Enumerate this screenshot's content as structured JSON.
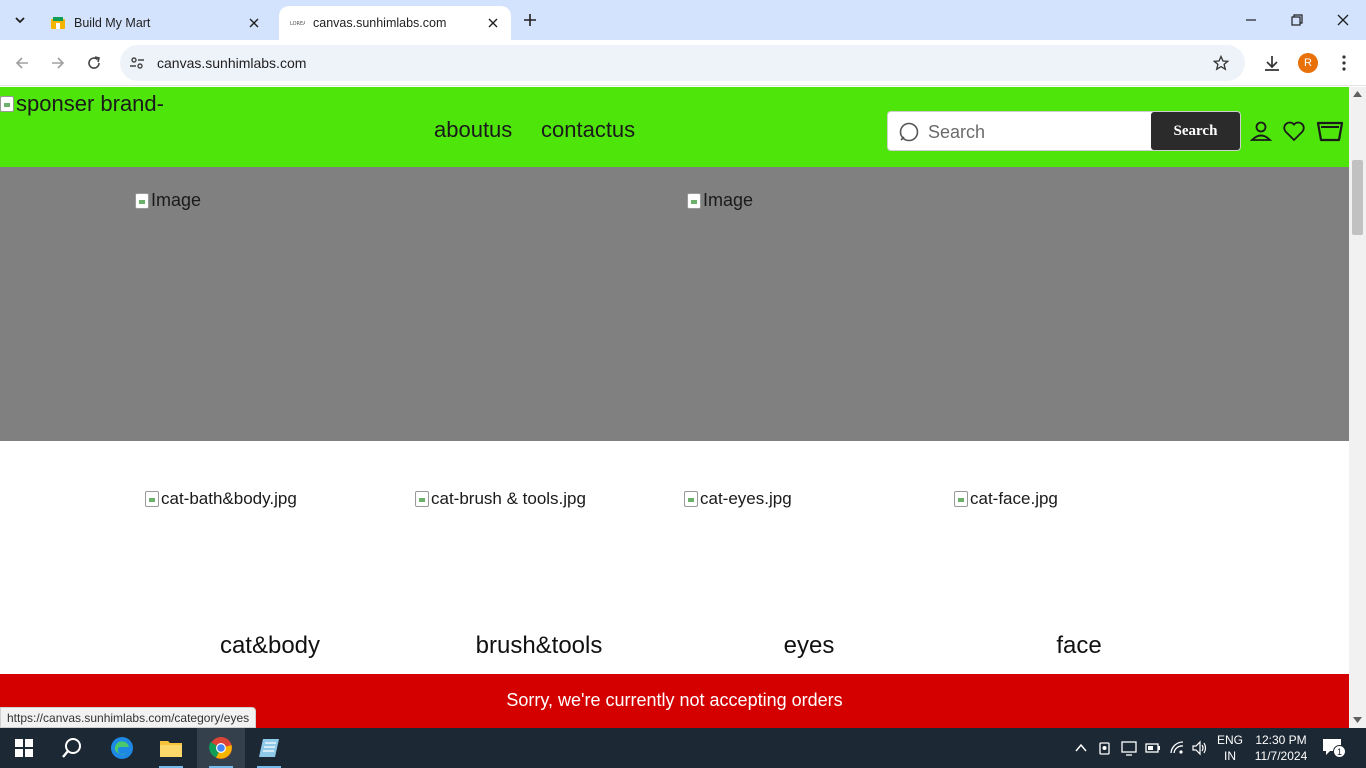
{
  "browser": {
    "tabs": [
      {
        "title": "Build My Mart",
        "active": false
      },
      {
        "title": "canvas.sunhimlabs.com",
        "active": true
      }
    ],
    "url": "canvas.sunhimlabs.com",
    "profile_initial": "R",
    "status_url": "https://canvas.sunhimlabs.com/category/eyes"
  },
  "site": {
    "header_color": "#4ee50b",
    "logo_alt": "sponser brand-",
    "nav": [
      "aboutus",
      "contactus"
    ],
    "search": {
      "placeholder": "Search",
      "button": "Search"
    },
    "banner": {
      "images": [
        "Image",
        "Image"
      ]
    },
    "categories": [
      {
        "img_alt": "cat-bath&body.jpg",
        "name": "cat&body"
      },
      {
        "img_alt": "cat-brush & tools.jpg",
        "name": "brush&tools"
      },
      {
        "img_alt": "cat-eyes.jpg",
        "name": "eyes"
      },
      {
        "img_alt": "cat-face.jpg",
        "name": "face"
      }
    ],
    "notice": "Sorry, we're currently not accepting orders",
    "notice_color": "#d40000"
  },
  "taskbar": {
    "lang": "ENG",
    "region": "IN",
    "time": "12:30 PM",
    "date": "11/7/2024",
    "notifications": "1"
  }
}
